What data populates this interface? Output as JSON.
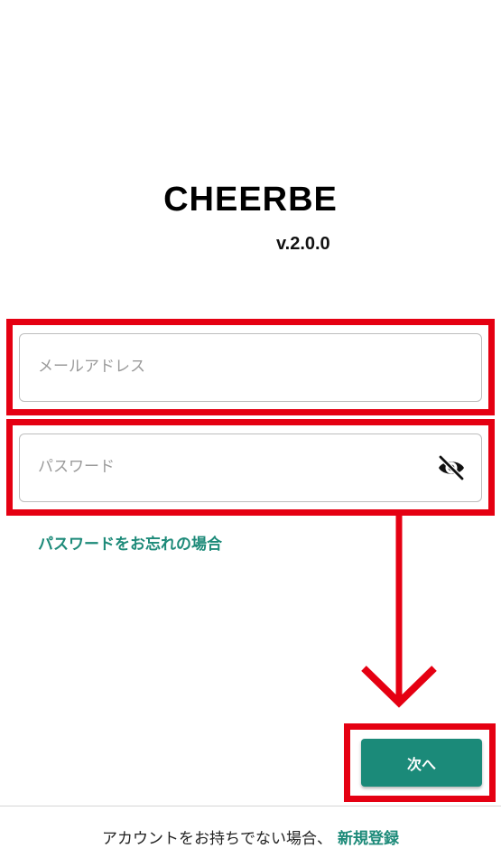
{
  "app": {
    "logo": "CHEERBE",
    "version": "v.2.0.0"
  },
  "login": {
    "email_placeholder": "メールアドレス",
    "email_value": "",
    "password_placeholder": "パスワード",
    "password_value": "",
    "password_toggle_icon": "eye-slash-icon",
    "forgot_password_label": "パスワードをお忘れの場合",
    "next_button_label": "次へ"
  },
  "footer": {
    "no_account_text": "アカウントをお持ちでない場合、",
    "register_label": "新規登録"
  },
  "annotations": {
    "highlight_color": "#e50012",
    "arrow_icon": "down-arrow-icon"
  },
  "theme": {
    "accent": "#1b8a79",
    "link": "#1d8a79"
  }
}
